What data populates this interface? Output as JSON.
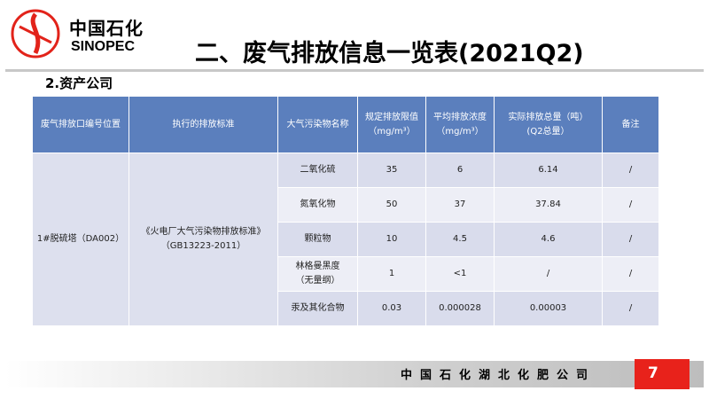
{
  "logo": {
    "cn": "中国石化",
    "en": "SINOPEC"
  },
  "title": "二、废气排放信息一览表(2021Q2)",
  "section_title": "2.资产公司",
  "table": {
    "headers": [
      [
        "废气排放口编号位置"
      ],
      [
        "执行的排放标准"
      ],
      [
        "大气污染物名称"
      ],
      [
        "规定排放限值",
        "（mg/m³）"
      ],
      [
        "平均排放浓度",
        "（mg/m³）"
      ],
      [
        "实际排放总量（吨）",
        "(Q2总量）"
      ],
      [
        "备注"
      ]
    ],
    "outlet": "1#脱硫塔（DA002）",
    "standard": [
      "《火电厂大气污染物排放标准》",
      "（GB13223-2011）"
    ],
    "rows": [
      {
        "pollutant": [
          "二氧化硫"
        ],
        "limit": "35",
        "avg": "6",
        "total": "6.14",
        "note": "/"
      },
      {
        "pollutant": [
          "氮氧化物"
        ],
        "limit": "50",
        "avg": "37",
        "total": "37.84",
        "note": "/"
      },
      {
        "pollutant": [
          "颗粒物"
        ],
        "limit": "10",
        "avg": "4.5",
        "total": "4.6",
        "note": "/"
      },
      {
        "pollutant": [
          "林格曼黑度",
          "（无量纲）"
        ],
        "limit": "1",
        "avg": "<1",
        "total": "/",
        "note": "/"
      },
      {
        "pollutant": [
          "汞及其化合物"
        ],
        "limit": "0.03",
        "avg": "0.000028",
        "total": "0.00003",
        "note": "/"
      }
    ]
  },
  "footer": {
    "company": "中国石化湖北化肥公司",
    "page": "7"
  },
  "colors": {
    "header_bg": "#5b7fbd",
    "row_a": "#d9dcec",
    "row_b": "#edeef6",
    "page_badge": "#e8221b"
  }
}
